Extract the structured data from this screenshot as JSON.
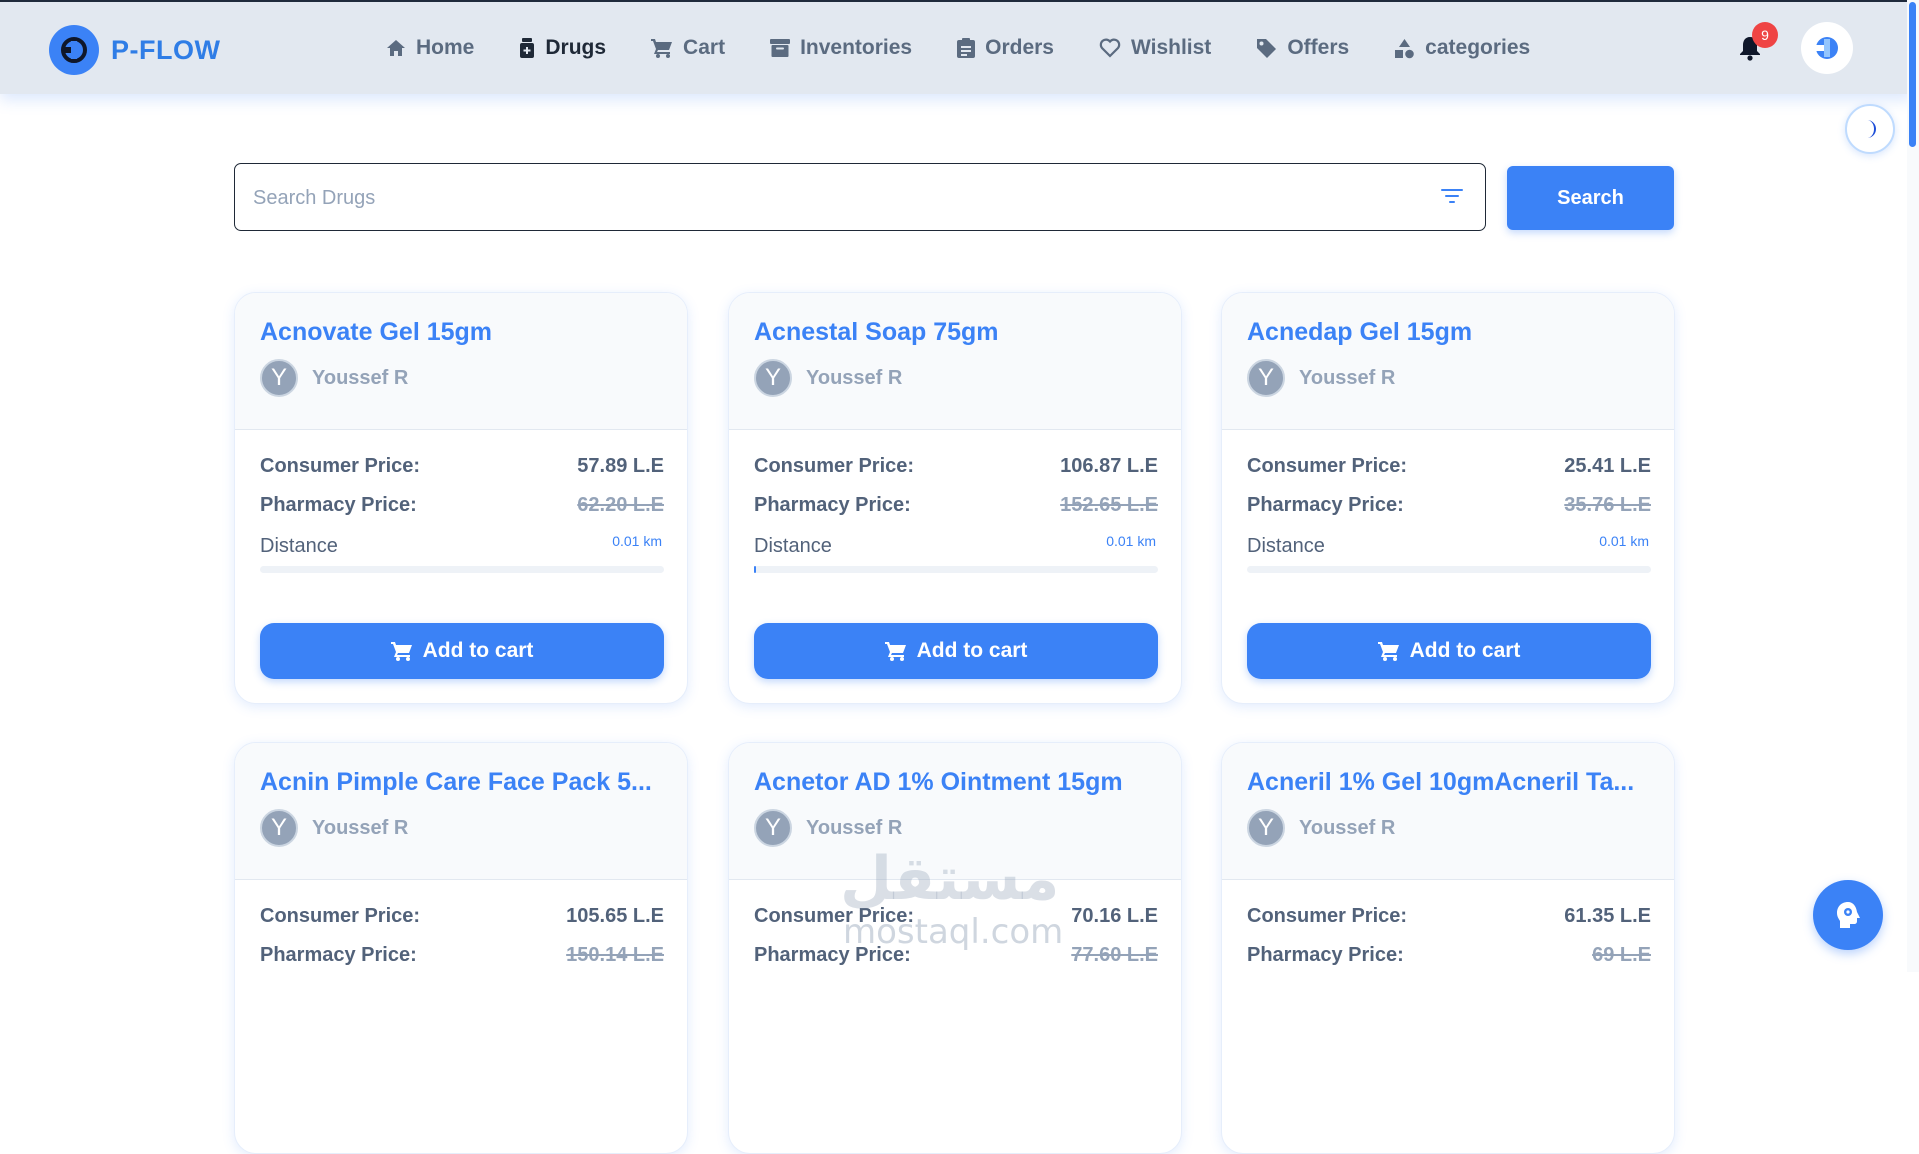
{
  "brand": {
    "name": "P-FLOW"
  },
  "nav": {
    "items": [
      {
        "label": "Home",
        "icon": "home-icon",
        "active": false
      },
      {
        "label": "Drugs",
        "icon": "medicine-bottle-icon",
        "active": true
      },
      {
        "label": "Cart",
        "icon": "cart-icon",
        "active": false
      },
      {
        "label": "Inventories",
        "icon": "archive-box-icon",
        "active": false
      },
      {
        "label": "Orders",
        "icon": "clipboard-icon",
        "active": false
      },
      {
        "label": "Wishlist",
        "icon": "heart-icon",
        "active": false
      },
      {
        "label": "Offers",
        "icon": "tag-icon",
        "active": false
      },
      {
        "label": "categories",
        "icon": "shapes-icon",
        "active": false
      }
    ],
    "notification_count": "9"
  },
  "search": {
    "placeholder": "Search Drugs",
    "button_label": "Search"
  },
  "labels": {
    "consumer_price": "Consumer Price:",
    "pharmacy_price": "Pharmacy Price:",
    "distance": "Distance",
    "add_to_cart": "Add to cart"
  },
  "products": [
    {
      "name": "Acnovate Gel 15gm",
      "seller_initial": "Y",
      "seller": "Youssef R",
      "consumer_price": "57.89 L.E",
      "pharmacy_price": "62.20 L.E",
      "distance": "0.01 km",
      "distance_fill": 0
    },
    {
      "name": "Acnestal Soap 75gm",
      "seller_initial": "Y",
      "seller": "Youssef R",
      "consumer_price": "106.87 L.E",
      "pharmacy_price": "152.65 L.E",
      "distance": "0.01 km",
      "distance_fill": 0.005
    },
    {
      "name": "Acnedap Gel 15gm",
      "seller_initial": "Y",
      "seller": "Youssef R",
      "consumer_price": "25.41 L.E",
      "pharmacy_price": "35.76 L.E",
      "distance": "0.01 km",
      "distance_fill": 0
    },
    {
      "name": "Acnin Pimple Care Face Pack 5...",
      "seller_initial": "Y",
      "seller": "Youssef R",
      "consumer_price": "105.65 L.E",
      "pharmacy_price": "150.14 L.E"
    },
    {
      "name": "Acnetor AD 1% Ointment 15gm",
      "seller_initial": "Y",
      "seller": "Youssef R",
      "consumer_price": "70.16 L.E",
      "pharmacy_price": "77.60 L.E"
    },
    {
      "name": "Acneril 1% Gel 10gmAcneril Ta...",
      "seller_initial": "Y",
      "seller": "Youssef R",
      "consumer_price": "61.35 L.E",
      "pharmacy_price": "69 L.E"
    }
  ],
  "watermark": {
    "arabic": "مستقل",
    "latin": "mostaql.com"
  },
  "colors": {
    "accent": "#3b82f6",
    "nav_bg": "#e2e8f0",
    "badge": "#ef4444"
  }
}
